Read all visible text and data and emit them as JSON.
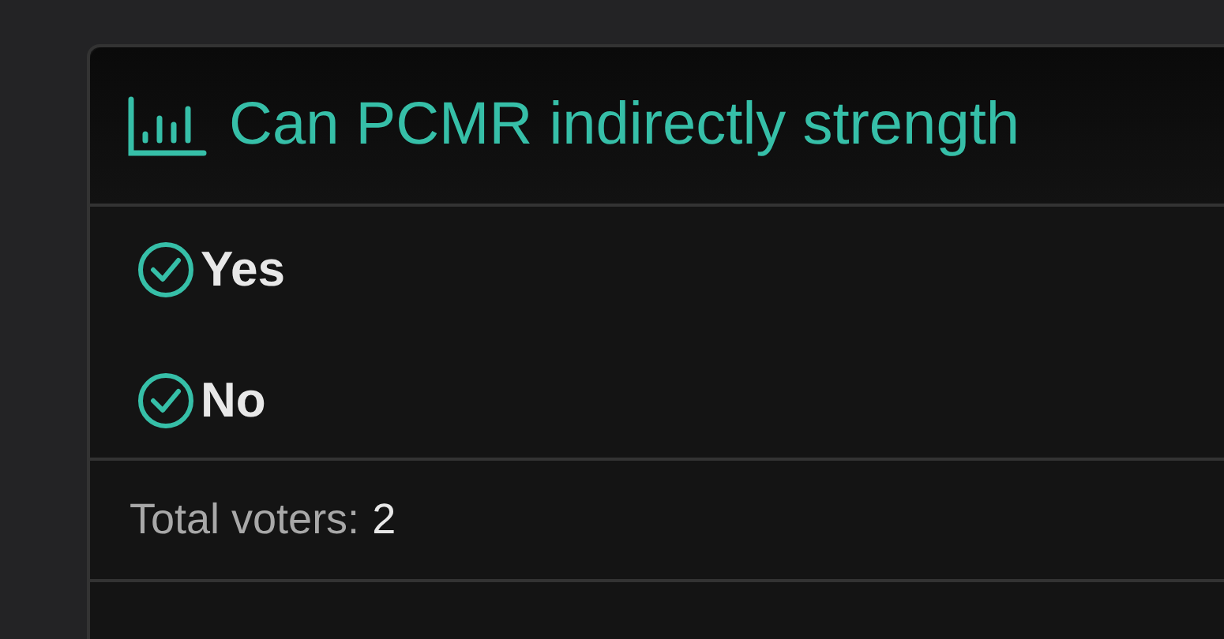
{
  "poll": {
    "title": "Can PCMR indirectly strength",
    "options": [
      {
        "label": "Yes"
      },
      {
        "label": "No"
      }
    ],
    "total_label": "Total voters:",
    "total_count": "2"
  }
}
